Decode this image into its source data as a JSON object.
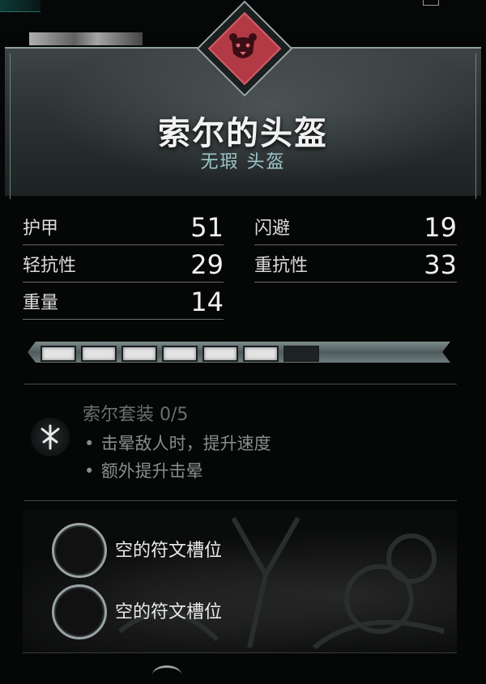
{
  "item": {
    "name": "索尔的头盔",
    "quality_type": "无瑕 头盔",
    "emblem_icon": "bear-head-icon",
    "emblem_color": "#b23a45"
  },
  "stats": [
    {
      "label": "护甲",
      "value": "51"
    },
    {
      "label": "闪避",
      "value": "19"
    },
    {
      "label": "轻抗性",
      "value": "29"
    },
    {
      "label": "重抗性",
      "value": "33"
    },
    {
      "label": "重量",
      "value": "14"
    }
  ],
  "upgrade": {
    "filled": 6,
    "total": 7
  },
  "set_bonus": {
    "title": "索尔套装 0/5",
    "icon": "rune-symbol-icon",
    "effects": [
      "击晕敌人时，提升速度",
      "额外提升击晕"
    ],
    "bullet": "•"
  },
  "rune_slots": [
    {
      "label": "空的符文槽位"
    },
    {
      "label": "空的符文槽位"
    }
  ]
}
